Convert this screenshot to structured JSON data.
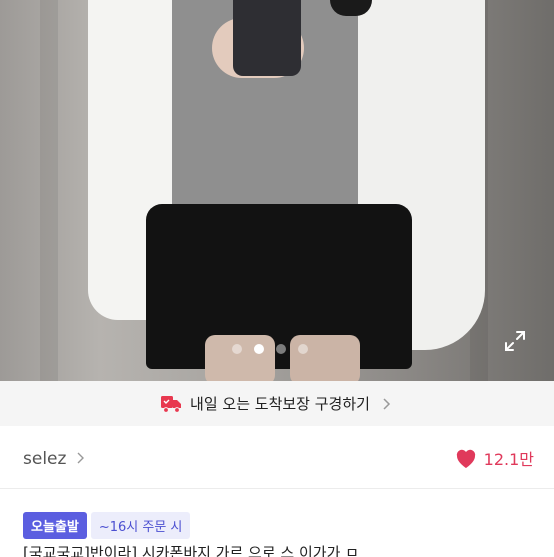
{
  "gallery": {
    "total_images": 4,
    "active_index": 1,
    "fullscreen_icon": "expand-arrows-icon"
  },
  "delivery_banner": {
    "icon": "truck-icon",
    "icon_color": "#e8384f",
    "label": "내일 오는 도착보장 구경하기"
  },
  "shop": {
    "name": "selez",
    "like_icon": "heart-icon",
    "like_color": "#e0395b",
    "like_count": "12.1만"
  },
  "badges": {
    "primary": "오늘출발",
    "secondary": "~16시 주문 시"
  },
  "product": {
    "title_partial": "[국교국교]반이라] 시카폰바지 가르 으로 스 이가가 ㅁ"
  }
}
